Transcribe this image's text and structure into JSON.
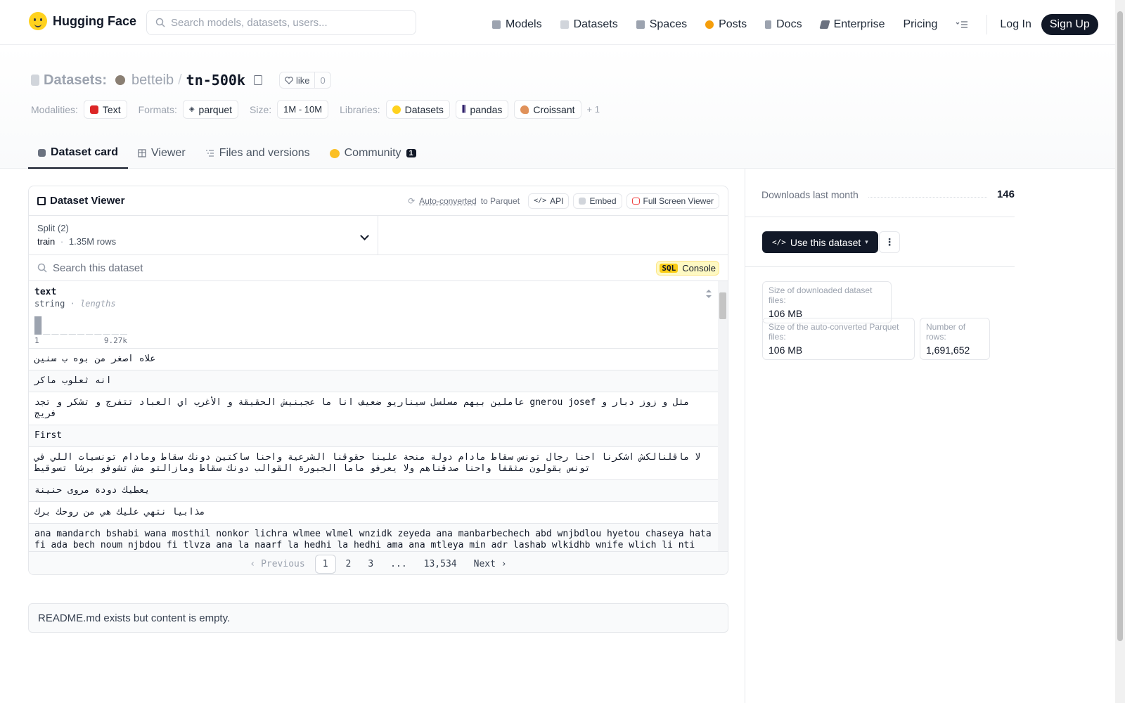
{
  "header": {
    "brand": "Hugging Face",
    "search_placeholder": "Search models, datasets, users...",
    "nav": [
      {
        "label": "Models",
        "icon": "cube-icon",
        "color": "#9ca3af"
      },
      {
        "label": "Datasets",
        "icon": "database-icon",
        "color": "#d1d5db"
      },
      {
        "label": "Spaces",
        "icon": "grid-icon",
        "color": "#9ca3af"
      },
      {
        "label": "Posts",
        "icon": "posts-icon",
        "color": "#f59e0b"
      },
      {
        "label": "Docs",
        "icon": "docs-icon",
        "color": "#9ca3af"
      },
      {
        "label": "Enterprise",
        "icon": "enterprise-icon",
        "color": "#6b7280"
      },
      {
        "label": "Pricing",
        "icon": "",
        "color": ""
      }
    ],
    "login": "Log In",
    "signup": "Sign Up"
  },
  "repo": {
    "section": "Datasets:",
    "owner": "betteib",
    "separator": "/",
    "name": "tn-500k",
    "like_label": "like",
    "like_count": "0",
    "modalities_label": "Modalities:",
    "modality": "Text",
    "formats_label": "Formats:",
    "format": "parquet",
    "size_label": "Size:",
    "size": "1M - 10M",
    "libraries_label": "Libraries:",
    "libraries": [
      "Datasets",
      "pandas",
      "Croissant"
    ],
    "more_libraries": "+ 1"
  },
  "tabs": [
    {
      "label": "Dataset card",
      "active": true
    },
    {
      "label": "Viewer",
      "active": false
    },
    {
      "label": "Files and versions",
      "active": false
    },
    {
      "label": "Community",
      "active": false,
      "badge": "1"
    }
  ],
  "viewer": {
    "title": "Dataset Viewer",
    "auto_converted": "Auto-converted",
    "to_parquet": "to Parquet",
    "api": "API",
    "embed": "Embed",
    "full_screen": "Full Screen Viewer",
    "split_label": "Split (2)",
    "split_value": "train",
    "split_dot": "·",
    "split_rows": "1.35M rows",
    "search_placeholder": "Search this dataset",
    "sql": "SQL",
    "console": "Console",
    "column": {
      "name": "text",
      "type": "string",
      "type_sep": "·",
      "type_extra": "lengths",
      "hist_min": "1",
      "hist_max": "9.27k",
      "histogram_fractions": [
        1.0,
        0.02,
        0.02,
        0.02,
        0.02,
        0.02,
        0.02,
        0.02,
        0.02,
        0.02,
        0.02
      ]
    },
    "rows": [
      {
        "text": "علاه اصغر من بوه ب سنين",
        "rtl": true
      },
      {
        "text": "انه ثعلوب ماكر",
        "rtl": true
      },
      {
        "text": "مثل و زوز دبار و gnerou josef عاملين بيهم مسلسل سيناريو ضعيف انا ما عجبنيش الحقيقة و الأغرب اي العباد تتفرج و تشكر و تجد فريج",
        "rtl": true
      },
      {
        "text": "First",
        "rtl": false
      },
      {
        "text": "لا ماقلنالكش اشكرنا احنا رجال تونس سقاط مادام دولة منحة علينا حقوقنا الشرعية واحنا ساكتين دونك سقاط ومادام تونسيات اللي في تونس يقولون مثقفا واحنا صدقناهم ولا يعرفو ماما الجبورة القوالب دونك سقاط ومازالتو مش تشوفو برشا تسوقيط",
        "rtl": true
      },
      {
        "text": "يعطيك دودة مروى حنينة",
        "rtl": true
      },
      {
        "text": "مذابيا نتهي عليك هي من روحك برك",
        "rtl": true
      },
      {
        "text": "ana mandarch bshabi wana mosthil nonkor lichra wlmee wlmel wnzidk zeyeda ana manbarbechech abd wnjbdlou hyetou chaseya hata fi ada bech noum njbdou fi tlvza ana la naarf la hedhi la hedhi ama ana mtleya min adr lashab wlkidhb wnife wlich li nti defe aliha wark lahlib…",
        "rtl": false
      }
    ],
    "pagination": {
      "previous": "Previous",
      "pages": [
        "1",
        "2",
        "3",
        "...",
        "13,534"
      ],
      "current": "1",
      "next": "Next"
    }
  },
  "readme_notice": "README.md exists but content is empty.",
  "sidebar": {
    "downloads_label": "Downloads last month",
    "downloads_value": "146",
    "use_button": "Use this dataset",
    "stats": [
      {
        "label": "Size of downloaded dataset files:",
        "value": "106 MB"
      },
      {
        "label": "Size of the auto-converted Parquet files:",
        "value": "106 MB"
      },
      {
        "label": "Number of rows:",
        "value": "1,691,652"
      }
    ]
  }
}
